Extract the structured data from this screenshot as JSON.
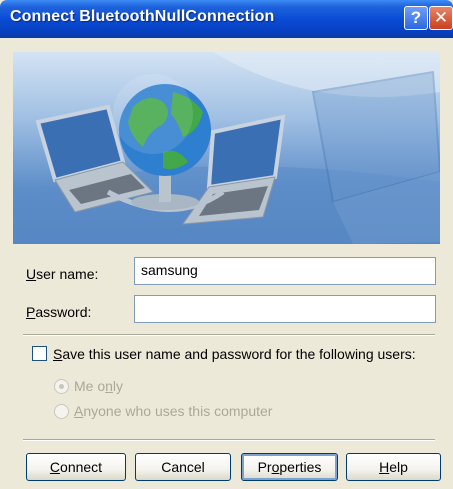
{
  "window": {
    "title": "Connect BluetoothNullConnection",
    "help_glyph": "?",
    "close_glyph": "✕"
  },
  "form": {
    "user_name_label_u": "U",
    "user_name_label_rest": "ser name:",
    "user_name_value": "samsung",
    "password_label_u": "P",
    "password_label_rest": "assword:",
    "password_value": ""
  },
  "save": {
    "checkbox_label_u": "S",
    "checkbox_label_rest": "ave this user name and password for the following users:",
    "checked": false,
    "options": [
      {
        "pre": "Me o",
        "u": "n",
        "post": "ly",
        "selected": true,
        "enabled": false
      },
      {
        "pre": "",
        "u": "A",
        "post": "nyone who uses this computer",
        "selected": false,
        "enabled": false
      }
    ]
  },
  "buttons": {
    "connect_u": "C",
    "connect_rest": "onnect",
    "cancel": "Cancel",
    "properties_pre": "Pr",
    "properties_u": "o",
    "properties_post": "perties",
    "help_u": "H",
    "help_rest": "elp"
  },
  "icons": [
    "globe-icon",
    "laptop-icon",
    "help-icon",
    "close-icon"
  ],
  "colors": {
    "titlebar": "#0a4cd6",
    "close_button": "#c9401c",
    "dialog_bg": "#ece9d8"
  }
}
